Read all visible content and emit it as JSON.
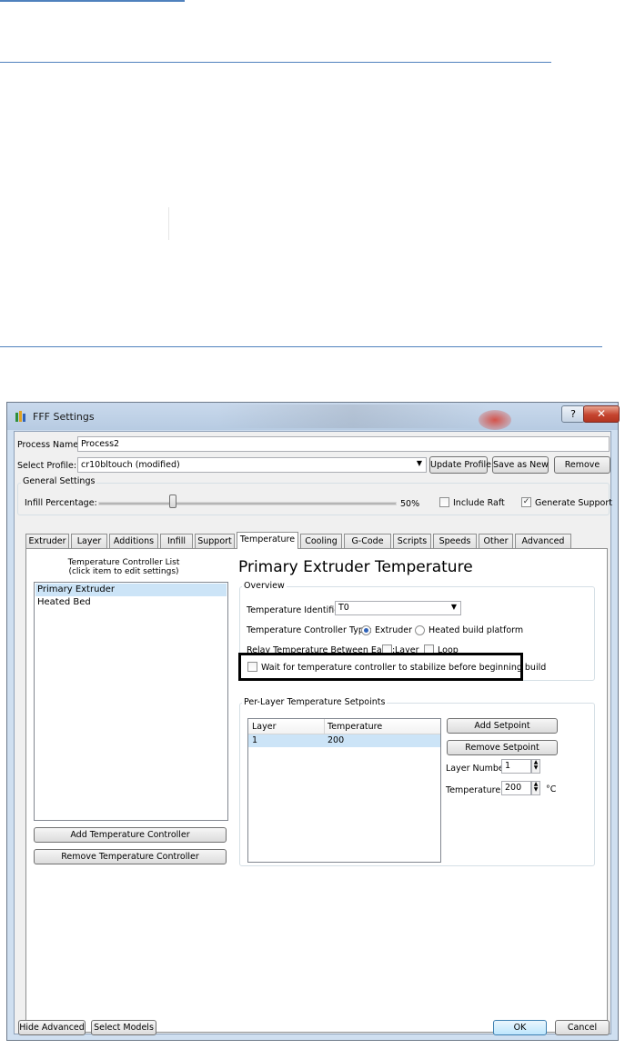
{
  "window": {
    "title": "FFF Settings",
    "help": "?",
    "close": "✕"
  },
  "process_name": {
    "label": "Process Name:",
    "value": "Process2"
  },
  "profile": {
    "label": "Select Profile:",
    "value": "cr10bltouch (modified)",
    "update": "Update Profile",
    "save_new": "Save as New",
    "remove": "Remove"
  },
  "general": {
    "title": "General Settings",
    "infill_label": "Infill Percentage:",
    "infill_value": "50%",
    "infill_level": 0.5,
    "include_raft": "Include Raft",
    "include_raft_checked": false,
    "gen_support": "Generate Support",
    "gen_support_checked": true
  },
  "tabs": [
    "Extruder",
    "Layer",
    "Additions",
    "Infill",
    "Support",
    "Temperature",
    "Cooling",
    "G-Code",
    "Scripts",
    "Speeds",
    "Other",
    "Advanced"
  ],
  "active_tab": "Temperature",
  "controller_list": {
    "caption1": "Temperature Controller List",
    "caption2": "(click item to edit settings)",
    "items": [
      "Primary Extruder",
      "Heated Bed"
    ],
    "add": "Add Temperature Controller",
    "remove": "Remove Temperature Controller"
  },
  "heading": "Primary Extruder Temperature",
  "overview": {
    "title": "Overview",
    "identifier_label": "Temperature Identifier",
    "identifier_value": "T0",
    "type_label": "Temperature Controller Type:",
    "type_extruder": "Extruder",
    "type_platform": "Heated build platform",
    "relay_label": "Relay Temperature Between Each:",
    "relay_layer": "Layer",
    "relay_loop": "Loop",
    "wait_label": "Wait for temperature controller to stabilize before beginning build"
  },
  "setpoints": {
    "title": "Per-Layer Temperature Setpoints",
    "col_layer": "Layer",
    "col_temp": "Temperature",
    "rows": [
      {
        "layer": "1",
        "temp": "200"
      }
    ],
    "add": "Add Setpoint",
    "remove": "Remove Setpoint",
    "layer_label": "Layer Number",
    "layer_value": "1",
    "temp_label": "Temperature",
    "temp_value": "200",
    "unit": "°C"
  },
  "footer": {
    "hide_advanced": "Hide Advanced",
    "select_models": "Select Models",
    "ok": "OK",
    "cancel": "Cancel"
  },
  "colors": {
    "doc_rule": "#4f81bd",
    "highlight_box": "#000000",
    "selection": "#cce4f7"
  }
}
